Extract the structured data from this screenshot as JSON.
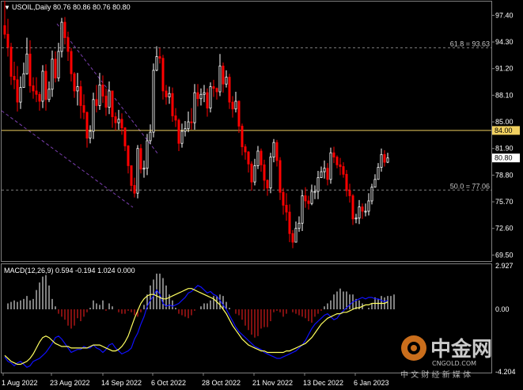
{
  "header": {
    "symbol_line": "USOIL,Daily  80.76 80.86 80.76 80.80"
  },
  "levels": {
    "fib_top_label": "61.8 = 93.63",
    "fib_top_value": 93.63,
    "fib_bottom_label": "50.0 = 77.06",
    "fib_bottom_value": 77.06,
    "hline_value": 84.0,
    "hline_label": "84.00",
    "last_price_label": "80.80",
    "last_price_value": 80.8
  },
  "colors": {
    "up": "#ffffff",
    "down": "#ff0000",
    "hline": "#f0d060",
    "grid": "#808080",
    "channel": "#7b3fb0",
    "macd": "#1010ff",
    "signal": "#ffff60"
  },
  "macd": {
    "label": "MACD(12,26,9) 0.594 -0.194 1.024 0.000",
    "ticks": [
      "2.927",
      "0.00",
      "-4.204"
    ],
    "range": [
      -4.204,
      2.927
    ]
  },
  "watermark": {
    "brand": "中金网",
    "site": "CNGOLD.COM",
    "tagline": "中 文 财 经 新 媒 体"
  },
  "chart_data": {
    "type": "candlestick",
    "ylim": [
      68.8,
      99.0
    ],
    "y_ticks": [
      "97.40",
      "94.30",
      "91.20",
      "88.10",
      "85.00",
      "81.90",
      "78.80",
      "75.70",
      "72.60",
      "69.50"
    ],
    "x_ticks": [
      "1 Aug 2022",
      "23 Aug 2022",
      "14 Sep 2022",
      "6 Oct 2022",
      "28 Oct 2022",
      "21 Nov 2022",
      "13 Dec 2022",
      "6 Jan 2023"
    ],
    "close": [
      95.2,
      93.7,
      90.3,
      89.9,
      87.3,
      89.0,
      90.6,
      92.9,
      89.2,
      88.6,
      88.2,
      87.4,
      90.9,
      87.6,
      88.8,
      92.3,
      90.1,
      93.2,
      96.6,
      94.8,
      93.2,
      90.6,
      88.6,
      89.1,
      86.9,
      86.1,
      83.1,
      83.9,
      87.6,
      86.9,
      89.3,
      88.0,
      86.7,
      88.6,
      85.6,
      84.9,
      85.3,
      84.3,
      82.2,
      79.9,
      77.6,
      76.7,
      81.9,
      79.5,
      79.6,
      82.8,
      83.8,
      91.0,
      92.6,
      92.4,
      88.6,
      87.9,
      88.3,
      85.7,
      85.2,
      82.5,
      83.9,
      84.2,
      85.0,
      84.9,
      88.4,
      87.7,
      88.2,
      88.4,
      86.6,
      89.1,
      88.9,
      88.5,
      91.5,
      89.4,
      90.2,
      87.3,
      86.5,
      87.4,
      84.5,
      82.1,
      81.5,
      80.1,
      78.0,
      79.9,
      81.6,
      80.0,
      78.2,
      77.3,
      80.9,
      82.6,
      80.5,
      76.8,
      75.3,
      74.5,
      72.0,
      71.0,
      72.6,
      73.2,
      76.4,
      75.8,
      75.5,
      76.9,
      76.9,
      78.5,
      79.2,
      79.6,
      78.3,
      81.4,
      80.9,
      80.0,
      79.8,
      78.9,
      77.0,
      76.4,
      73.7,
      73.8,
      75.1,
      74.6,
      74.6,
      75.8,
      77.4,
      78.3,
      79.7,
      81.2,
      80.3,
      80.8
    ],
    "high": [
      99.1,
      97.0,
      94.2,
      92.0,
      91.5,
      90.3,
      91.9,
      94.8,
      94.5,
      90.2,
      90.2,
      88.5,
      91.6,
      91.7,
      89.7,
      93.3,
      93.2,
      94.2,
      97.1,
      97.2,
      95.5,
      93.6,
      90.8,
      90.7,
      89.8,
      88.2,
      86.2,
      84.6,
      88.4,
      89.3,
      90.7,
      90.4,
      88.9,
      89.7,
      88.6,
      86.1,
      86.4,
      86.0,
      84.4,
      82.3,
      79.9,
      78.5,
      82.3,
      82.4,
      80.5,
      83.6,
      84.7,
      91.8,
      93.8,
      93.6,
      92.8,
      89.3,
      89.1,
      89.0,
      86.6,
      85.4,
      84.8,
      85.1,
      86.2,
      86.6,
      89.4,
      89.4,
      88.9,
      89.3,
      88.9,
      89.6,
      89.9,
      89.0,
      92.9,
      91.9,
      91.0,
      90.6,
      88.0,
      88.5,
      87.5,
      84.8,
      82.4,
      81.6,
      80.4,
      80.7,
      82.2,
      81.9,
      80.6,
      78.3,
      81.4,
      83.0,
      82.9,
      80.9,
      77.3,
      76.7,
      75.4,
      72.4,
      73.4,
      74.0,
      77.0,
      77.4,
      76.4,
      77.7,
      77.6,
      79.3,
      79.8,
      80.5,
      80.2,
      82.0,
      82.1,
      81.1,
      80.8,
      80.3,
      79.4,
      77.8,
      76.6,
      74.3,
      75.9,
      75.5,
      75.5,
      76.7,
      77.8,
      78.9,
      80.2,
      81.9,
      81.7,
      81.4
    ],
    "low": [
      94.7,
      92.6,
      89.3,
      88.8,
      86.2,
      86.5,
      89.3,
      90.5,
      88.4,
      87.7,
      87.3,
      86.3,
      86.6,
      86.3,
      87.3,
      87.9,
      89.6,
      89.7,
      92.5,
      94.0,
      92.1,
      89.7,
      87.8,
      86.9,
      85.4,
      85.3,
      82.0,
      82.5,
      83.0,
      86.1,
      86.4,
      87.2,
      85.7,
      85.9,
      84.3,
      84.0,
      84.1,
      83.5,
      81.6,
      79.0,
      76.9,
      76.2,
      76.1,
      79.0,
      78.5,
      78.8,
      82.4,
      83.2,
      90.9,
      91.8,
      87.6,
      87.0,
      87.1,
      85.0,
      84.4,
      81.6,
      82.0,
      83.3,
      83.8,
      84.1,
      84.1,
      86.8,
      86.9,
      87.3,
      85.6,
      86.1,
      87.9,
      87.6,
      88.0,
      88.4,
      89.0,
      86.5,
      85.5,
      86.1,
      83.7,
      81.1,
      80.6,
      79.1,
      77.0,
      77.6,
      79.5,
      79.2,
      77.1,
      76.4,
      76.7,
      80.3,
      79.8,
      75.9,
      74.2,
      73.5,
      71.0,
      70.3,
      71.3,
      72.2,
      72.3,
      75.0,
      74.8,
      75.3,
      76.0,
      76.0,
      78.6,
      78.4,
      77.6,
      77.8,
      80.2,
      79.6,
      78.8,
      78.5,
      76.3,
      75.6,
      73.0,
      73.2,
      73.1,
      73.7,
      74.0,
      74.1,
      75.4,
      77.5,
      78.6,
      79.2,
      79.8,
      80.2
    ],
    "macd_hist": [
      0.0,
      0.4,
      0.5,
      0.6,
      0.5,
      0.6,
      0.7,
      0.9,
      0.6,
      0.7,
      1.3,
      1.8,
      2.2,
      2.3,
      1.6,
      0.7,
      0.2,
      -0.3,
      -0.5,
      -0.7,
      -1.1,
      -1.3,
      -1.1,
      -0.6,
      -0.8,
      -0.5,
      -0.2,
      0.1,
      0.6,
      0.4,
      0.3,
      0.6,
      -0.1,
      0.4,
      0.2,
      0.0,
      -0.2,
      -0.3,
      -0.3,
      -0.1,
      -0.2,
      -0.4,
      -0.5,
      -0.2,
      0.3,
      1.0,
      1.6,
      2.0,
      2.4,
      2.4,
      2.1,
      1.6,
      1.0,
      0.6,
      0.1,
      -0.3,
      -0.4,
      -0.5,
      -0.6,
      -0.4,
      -0.1,
      0.0,
      0.2,
      0.4,
      0.4,
      0.6,
      0.9,
      0.9,
      1.0,
      0.9,
      0.5,
      0.1,
      0.0,
      -0.3,
      -0.4,
      -0.7,
      -1.1,
      -1.4,
      -1.7,
      -1.9,
      -1.8,
      -1.3,
      -1.2,
      -1.2,
      -0.8,
      -0.2,
      -0.1,
      -0.2,
      -0.5,
      -0.3,
      0.0,
      -0.2,
      -0.3,
      -0.4,
      -0.5,
      -0.6,
      -0.8,
      -0.9,
      -0.5,
      -0.3,
      -0.1,
      0.2,
      0.4,
      0.6,
      1.0,
      1.2,
      1.4,
      1.2,
      1.2,
      1.0,
      1.0,
      0.7,
      0.6,
      0.4,
      0.0,
      0.1,
      0.4,
      0.8,
      0.7,
      0.9,
      0.8,
      0.9,
      0.9,
      1.0
    ],
    "macd_line": [
      -3.2,
      -3.5,
      -3.6,
      -3.8,
      -3.6,
      -3.5,
      -3.7,
      -3.9,
      -3.8,
      -3.5,
      -3.4,
      -3.3,
      -3.1,
      -2.9,
      -2.6,
      -2.3,
      -1.9,
      -1.8,
      -2.0,
      -2.3,
      -2.6,
      -2.9,
      -2.8,
      -2.7,
      -2.7,
      -2.5,
      -2.6,
      -2.6,
      -2.4,
      -2.6,
      -2.7,
      -2.9,
      -2.7,
      -2.4,
      -2.3,
      -2.6,
      -2.8,
      -3.0,
      -2.9,
      -2.8,
      -2.6,
      -2.0,
      -1.6,
      -1.0,
      -0.5,
      0.2,
      0.6,
      0.9,
      1.3,
      1.0,
      0.4,
      0.2,
      0.3,
      0.2,
      0.3,
      0.4,
      0.6,
      0.8,
      1.1,
      1.2,
      1.4,
      1.6,
      1.5,
      1.3,
      1.1,
      1.2,
      1.0,
      0.9,
      0.6,
      0.3,
      0.0,
      -0.4,
      -0.8,
      -1.2,
      -1.5,
      -1.7,
      -1.9,
      -2.1,
      -2.3,
      -2.5,
      -2.6,
      -2.7,
      -2.9,
      -3.0,
      -3.1,
      -3.2,
      -3.3,
      -3.3,
      -3.2,
      -3.1,
      -3.0,
      -2.9,
      -2.8,
      -2.6,
      -2.4,
      -2.1,
      -1.7,
      -1.3,
      -1.0,
      -0.8,
      -0.6,
      -0.4,
      -0.3,
      -0.5,
      -0.7,
      -0.6,
      -0.3,
      -0.1,
      0.1,
      0.3,
      0.5,
      0.6,
      0.7,
      0.8,
      0.7,
      0.8,
      0.8,
      0.7,
      0.7,
      0.6,
      0.5,
      0.6
    ],
    "signal_line": [
      -3.1,
      -3.3,
      -3.5,
      -3.6,
      -3.7,
      -3.7,
      -3.6,
      -3.5,
      -3.3,
      -3.0,
      -2.6,
      -2.2,
      -1.9,
      -1.8,
      -1.9,
      -2.1,
      -2.3,
      -2.4,
      -2.5,
      -2.5,
      -2.5,
      -2.6,
      -2.6,
      -2.6,
      -2.6,
      -2.6,
      -2.6,
      -2.5,
      -2.4,
      -2.4,
      -2.4,
      -2.5,
      -2.6,
      -2.7,
      -2.8,
      -2.8,
      -2.7,
      -2.5,
      -2.2,
      -1.8,
      -1.2,
      -0.6,
      -0.1,
      0.4,
      0.7,
      0.9,
      1.0,
      1.0,
      0.9,
      0.8,
      0.7,
      0.7,
      0.8,
      0.9,
      1.0,
      1.1,
      1.2,
      1.3,
      1.4,
      1.4,
      1.3,
      1.2,
      1.1,
      1.0,
      0.9,
      0.8,
      0.7,
      0.5,
      0.3,
      0.0,
      -0.3,
      -0.7,
      -1.1,
      -1.4,
      -1.7,
      -2.0,
      -2.2,
      -2.4,
      -2.5,
      -2.6,
      -2.7,
      -2.8,
      -2.8,
      -2.9,
      -2.9,
      -2.9,
      -2.9,
      -2.9,
      -2.9,
      -2.8,
      -2.8,
      -2.7,
      -2.6,
      -2.5,
      -2.4,
      -2.3,
      -2.1,
      -1.9,
      -1.6,
      -1.3,
      -1.0,
      -0.8,
      -0.6,
      -0.5,
      -0.4,
      -0.3,
      -0.3,
      -0.2,
      -0.2,
      -0.1,
      0.0,
      0.1,
      0.1,
      0.2,
      0.3,
      0.3,
      0.4,
      0.4,
      0.4,
      0.4,
      0.4,
      0.5
    ]
  }
}
